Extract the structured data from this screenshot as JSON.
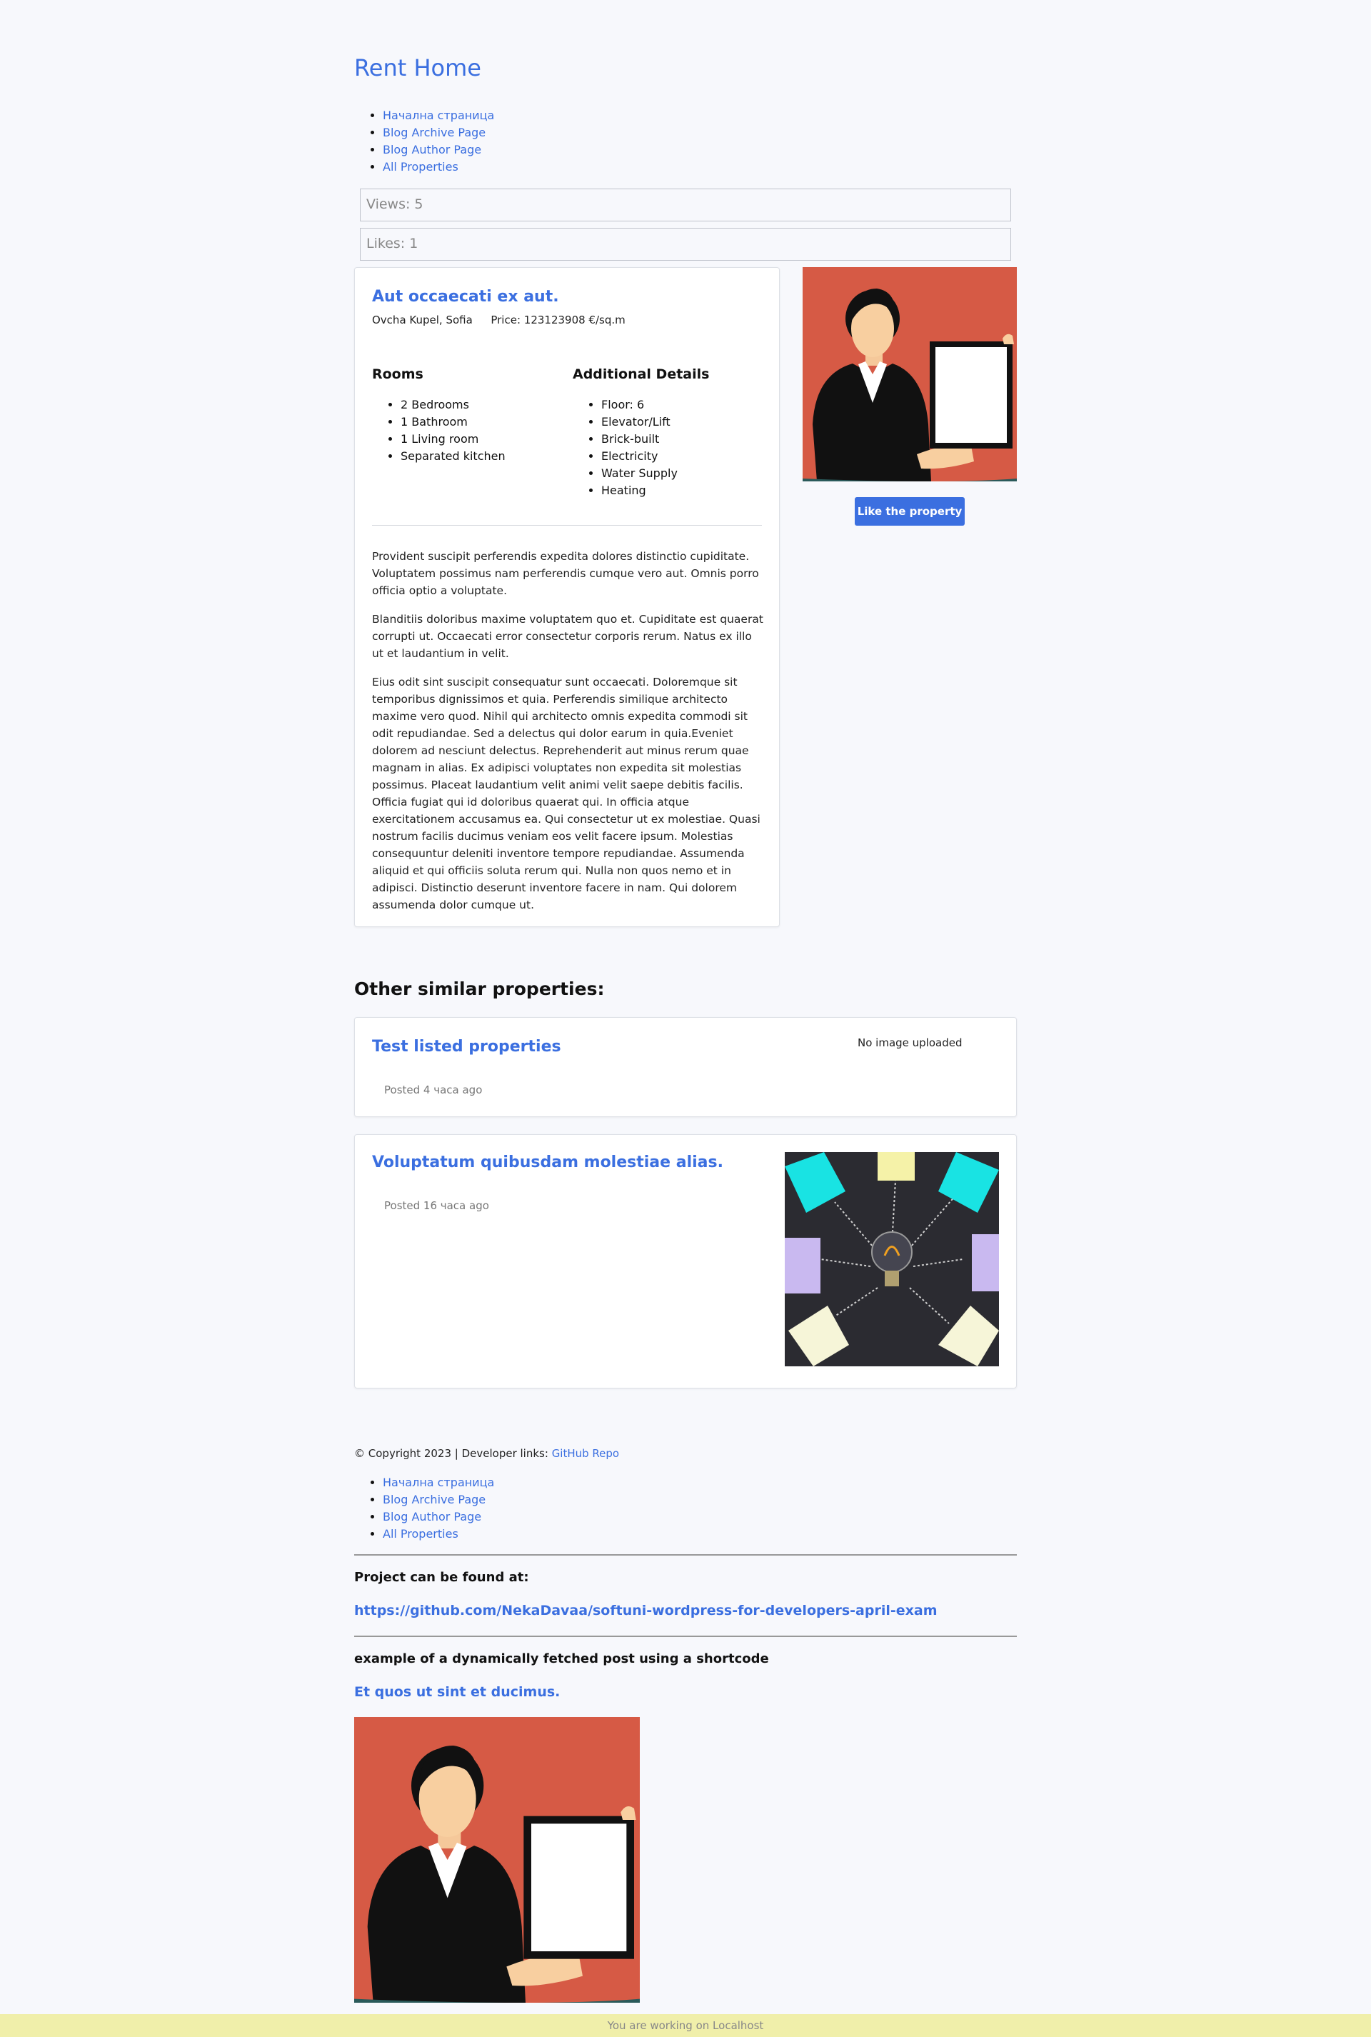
{
  "site": {
    "title": "Rent Home"
  },
  "nav": [
    "Начална страница",
    "Blog Archive Page",
    "Blog Author Page",
    "All Properties"
  ],
  "counters": {
    "views": "Views: 5",
    "likes": "Likes: 1"
  },
  "property": {
    "title": "Aut occaecati ex aut.",
    "location": "Ovcha Kupel, Sofia",
    "price": "Price: 123123908 €/sq.m",
    "rooms_heading": "Rooms",
    "rooms": [
      "2 Bedrooms",
      "1 Bathroom",
      "1 Living room",
      "Separated kitchen"
    ],
    "details_heading": "Additional Details",
    "details": [
      "Floor: 6",
      "Elevator/Lift",
      "Brick-built",
      "Electricity",
      "Water Supply",
      "Heating"
    ],
    "paragraphs": [
      "Provident suscipit perferendis expedita dolores distinctio cupiditate. Voluptatem possimus nam perferendis cumque vero aut. Omnis porro officia optio a voluptate.",
      "Blanditiis doloribus maxime voluptatem quo et. Cupiditate est quaerat corrupti ut. Occaecati error consectetur corporis rerum. Natus ex illo ut et laudantium in velit.",
      "Eius odit sint suscipit consequatur sunt occaecati. Doloremque sit temporibus dignissimos et quia. Perferendis similique architecto maxime vero quod. Nihil qui architecto omnis expedita commodi sit odit repudiandae. Sed a delectus qui dolor earum in quia.Eveniet dolorem ad nesciunt delectus. Reprehenderit aut minus rerum quae magnam in alias. Ex adipisci voluptates non expedita sit molestias possimus. Placeat laudantium velit animi velit saepe debitis facilis. Officia fugiat qui id doloribus quaerat qui. In officia atque exercitationem accusamus ea. Qui consectetur ut ex molestiae. Quasi nostrum facilis ducimus veniam eos velit facere ipsum. Molestias consequuntur deleniti inventore tempore repudiandae. Assumenda aliquid et qui officiis soluta rerum qui. Nulla non quos nemo et in adipisci. Distinctio deserunt inventore facere in nam. Qui dolorem assumenda dolor cumque ut."
    ],
    "like_button": "Like the property"
  },
  "similar": {
    "heading": "Other similar properties:",
    "items": [
      {
        "title": "Test listed properties",
        "posted": "Posted 4 часа ago",
        "no_image": "No image uploaded"
      },
      {
        "title": "Voluptatum quibusdam molestiae alias.",
        "posted": "Posted 16 часа ago"
      }
    ]
  },
  "footer": {
    "copyright": "© Copyright 2023 | Developer links: ",
    "repo_link": "GitHub Repo",
    "found_at": "Project can be found at:",
    "github_url": "https://github.com/NekaDavaa/softuni-wordpress-for-developers-april-exam",
    "shortcode_heading": "example of a dynamically fetched post using a shortcode",
    "shortcode_post": "Et quos ut sint et ducimus."
  },
  "status_bar": "You are working on Localhost",
  "colors": {
    "accent": "#3b6fe0",
    "background": "#f7f8fc",
    "status_bar": "#f0efaa",
    "image_bg": "#d65a45"
  },
  "images": {
    "agent": "woman-holding-tablet-illustration",
    "bulb": "lightbulb-sticky-notes-photo"
  }
}
